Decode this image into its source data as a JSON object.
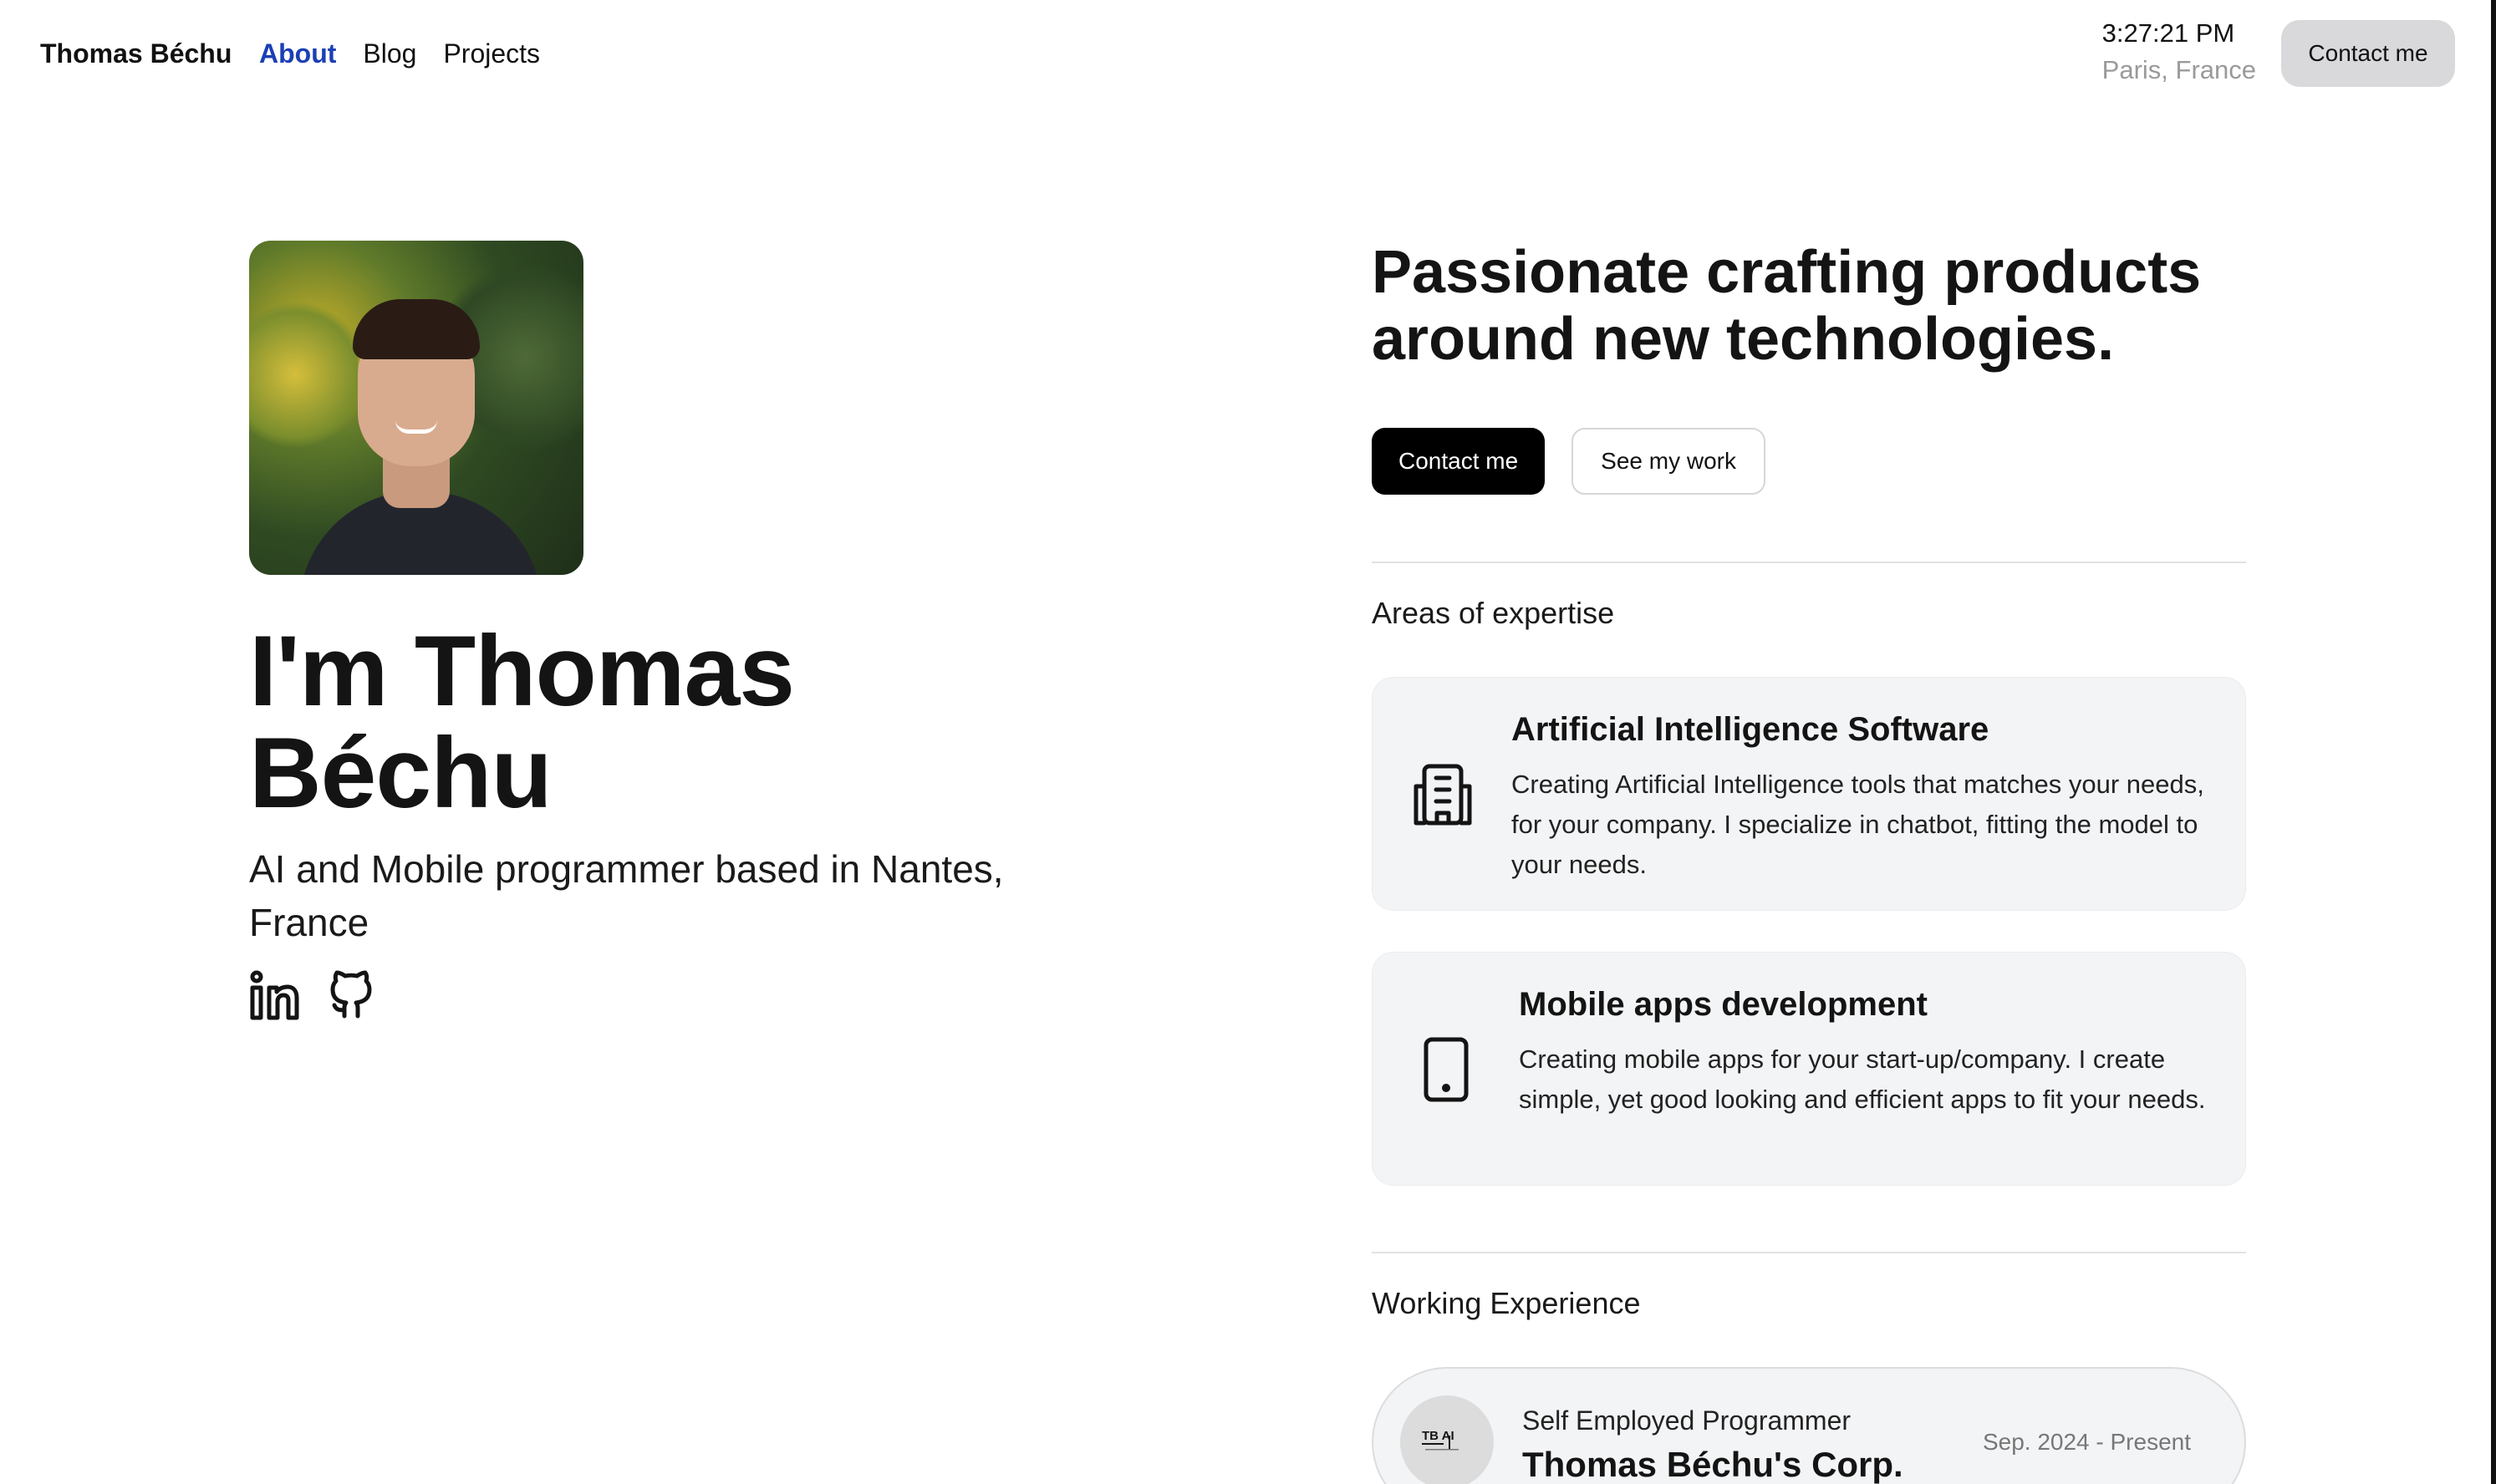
{
  "header": {
    "brand": "Thomas Béchu",
    "nav": [
      {
        "label": "About",
        "active": true
      },
      {
        "label": "Blog",
        "active": false
      },
      {
        "label": "Projects",
        "active": false
      }
    ],
    "time": "3:27:21 PM",
    "location": "Paris, France",
    "contact_label": "Contact me"
  },
  "hero": {
    "avatar_alt": "portrait photo",
    "name_line1": "I'm Thomas",
    "name_line2": "Béchu",
    "subtitle": "AI and Mobile programmer based in Nantes, France",
    "socials": [
      {
        "icon": "linkedin-icon"
      },
      {
        "icon": "github-icon"
      }
    ]
  },
  "intro": {
    "tagline_line1": "Passionate crafting products",
    "tagline_line2": "around new technologies.",
    "primary_button": "Contact me",
    "secondary_button": "See my work"
  },
  "expertise": {
    "title": "Areas of expertise",
    "items": [
      {
        "icon": "building-icon",
        "title": "Artificial Intelligence Software",
        "description": "Creating Artificial Intelligence tools that matches your needs, for your company. I specialize in chatbot, fitting the model to your needs."
      },
      {
        "icon": "smartphone-icon",
        "title": "Mobile apps development",
        "description": "Creating mobile apps for your start-up/company. I create simple, yet good looking and efficient apps to fit your needs."
      }
    ]
  },
  "experience": {
    "title": "Working Experience",
    "items": [
      {
        "logo_icon": "tb-ai-logo-icon",
        "logo_text": "TB AI",
        "role": "Self Employed Programmer",
        "company": "Thomas Béchu's Corp.",
        "dates": "Sep. 2024 - Present"
      }
    ]
  },
  "colors": {
    "accent": "#1b3fb5",
    "primary_button": "#000000",
    "card_bg": "#f3f4f6",
    "muted_text": "#9a9a9a"
  }
}
